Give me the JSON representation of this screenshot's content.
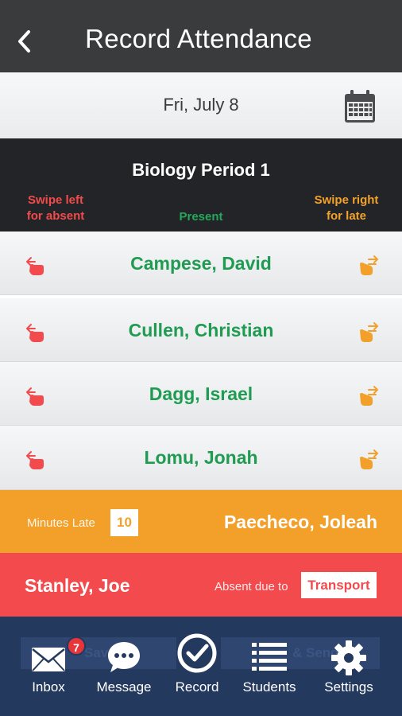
{
  "header": {
    "title": "Record Attendance",
    "back_icon": "chevron-left-icon"
  },
  "date_bar": {
    "date": "Fri, July 8",
    "calendar_icon": "calendar-icon"
  },
  "class": {
    "title": "Biology Period 1",
    "hint_absent": "Swipe left for absent",
    "hint_present": "Present",
    "hint_late": "Swipe right for late"
  },
  "students": [
    {
      "name": "Campese, David"
    },
    {
      "name": "Cullen, Christian"
    },
    {
      "name": "Dagg, Israel"
    },
    {
      "name": "Lomu, Jonah"
    }
  ],
  "late_entry": {
    "label": "Minutes Late",
    "minutes": "10",
    "name": "Paecheco, Joleah"
  },
  "absent_entry": {
    "name": "Stanley, Joe",
    "label": "Absent due to",
    "reason": "Transport"
  },
  "bottom_buttons": {
    "save": "Save",
    "save_send": "& Send"
  },
  "tabs": [
    {
      "label": "Inbox",
      "icon": "envelope-icon",
      "badge": "7"
    },
    {
      "label": "Message",
      "icon": "chat-bubble-icon"
    },
    {
      "label": "Record",
      "icon": "checkmark-circle-icon"
    },
    {
      "label": "Students",
      "icon": "list-icon"
    },
    {
      "label": "Settings",
      "icon": "gear-icon"
    }
  ],
  "colors": {
    "present": "#22a95a",
    "late": "#f2a02a",
    "absent": "#f24a4d",
    "tabbar": "#24395e",
    "header": "#3a3b3d"
  }
}
